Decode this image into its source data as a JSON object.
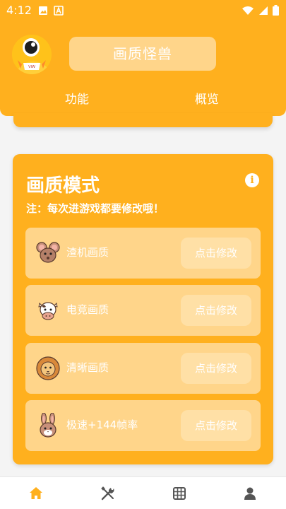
{
  "status_bar": {
    "time": "4:12",
    "icons": [
      "image-icon",
      "a-icon",
      "wifi-icon",
      "signal-icon",
      "battery-icon"
    ]
  },
  "header": {
    "app_title": "画质怪兽",
    "avatar_badge": "VIW",
    "tabs": [
      {
        "label": "功能"
      },
      {
        "label": "概览"
      }
    ]
  },
  "card": {
    "title": "画质模式",
    "note": "注：每次进游戏都要修改哦！",
    "info_icon": "i",
    "modes": [
      {
        "icon": "mouse-icon",
        "label": "渣机画质",
        "button": "点击修改"
      },
      {
        "icon": "cow-icon",
        "label": "电竞画质",
        "button": "点击修改"
      },
      {
        "icon": "lion-icon",
        "label": "清晰画质",
        "button": "点击修改"
      },
      {
        "icon": "rabbit-icon",
        "label": "极速+144帧率",
        "button": "点击修改"
      }
    ]
  },
  "bottom_nav": {
    "items": [
      {
        "icon": "home-icon",
        "active": true
      },
      {
        "icon": "tools-icon",
        "active": false
      },
      {
        "icon": "grid-icon",
        "active": false
      },
      {
        "icon": "person-icon",
        "active": false
      }
    ]
  },
  "colors": {
    "accent": "#ffb01e",
    "light_accent": "#ffd58a",
    "button_bg": "#ffe0a6",
    "nav_active": "#ffb01e",
    "nav_inactive": "#555555"
  }
}
